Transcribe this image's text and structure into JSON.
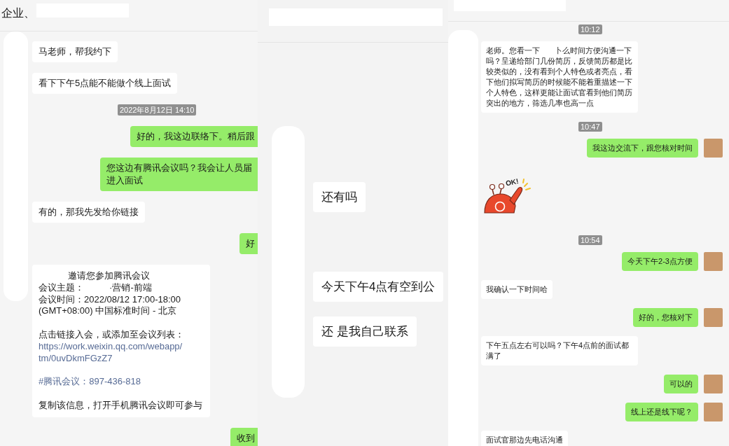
{
  "panels": [
    {
      "header": {
        "title": "企业、"
      },
      "messages": [
        {
          "kind": "incoming",
          "text": "马老师，帮我约下"
        },
        {
          "kind": "incoming",
          "text": "看下下午5点能不能做个线上面试"
        },
        {
          "kind": "time",
          "text": "2022年8月12日 14:10"
        },
        {
          "kind": "outgoing",
          "text": "好的，我这边联络下。稍后跟"
        },
        {
          "kind": "outgoing",
          "text": "您这边有腾讯会议吗？我会让人员届进入面试"
        },
        {
          "kind": "incoming",
          "text": "有的，那我先发给你链接"
        },
        {
          "kind": "outgoing",
          "text": "好"
        },
        {
          "kind": "card",
          "groups": [
            [
              {
                "kind": "title",
                "text": "邀请您参加腾讯会议"
              },
              {
                "kind": "plain",
                "text": "会议主题：          ·营销-前端"
              },
              {
                "kind": "plain",
                "text": "会议时间：2022/08/12 17:00-18:00 (GMT+08:00) 中国标准时间 - 北京"
              }
            ],
            [
              {
                "kind": "plain",
                "text": "点击链接入会，或添加至会议列表："
              },
              {
                "kind": "link",
                "text": "https://work.weixin.qq.com/webapp/tm/0uvDkmFGzZ7"
              }
            ],
            [
              {
                "kind": "link",
                "text": "#腾讯会议：897-436-818"
              }
            ],
            [
              {
                "kind": "plain",
                "text": "复制该信息，打开手机腾讯会议即可参与"
              }
            ]
          ]
        },
        {
          "kind": "outgoing",
          "text": "收到"
        }
      ]
    },
    {
      "messages": [
        {
          "kind": "incoming",
          "text": "还有吗"
        },
        {
          "kind": "incoming",
          "text": "今天下午4点有空到公"
        },
        {
          "kind": "incoming",
          "text": "还 是我自己联系"
        }
      ]
    },
    {
      "messages": [
        {
          "kind": "time",
          "text": "10:12"
        },
        {
          "kind": "incoming",
          "text": "老师。您看一下       卜么时间方便沟通一下吗？呈递给部门几份简历，反馈简历都是比较类似的，没有看到个人特色或者亮点，看下他们拟写简历的时候能不能着重描述一下个人特色，这样更能让面试官看到他们简历突出的地方，筛选几率也高一点"
        },
        {
          "kind": "time",
          "text": "10:47"
        },
        {
          "kind": "outgoing",
          "text": "我这边交流下，跟您核对时间",
          "avatar": true
        },
        {
          "kind": "sticker",
          "caption": "OK!"
        },
        {
          "kind": "time",
          "text": "10:54"
        },
        {
          "kind": "outgoing",
          "text": "今天下午2-3点方便",
          "avatar": true
        },
        {
          "kind": "incoming",
          "text": "我确认一下时间哈"
        },
        {
          "kind": "outgoing",
          "text": "好的，您核对下",
          "avatar": true
        },
        {
          "kind": "incoming",
          "text": "下午五点左右可以吗？下午4点前的面试都满了"
        },
        {
          "kind": "outgoing",
          "text": "可以的",
          "avatar": true
        },
        {
          "kind": "outgoing",
          "text": "线上还是线下呢？",
          "avatar": true
        },
        {
          "kind": "incoming",
          "text": "面试官那边先电话沟通"
        }
      ]
    }
  ]
}
